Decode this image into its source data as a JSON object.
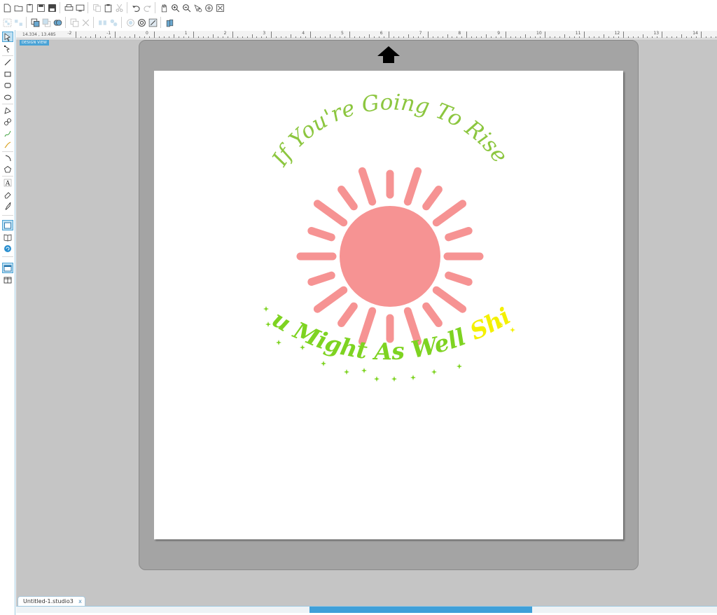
{
  "app": {
    "view_label": "DESIGN VIEW",
    "coordinate_readout": "14.334 , 13.485"
  },
  "ruler": {
    "labels": [
      "-2",
      "-1",
      "0",
      "1",
      "2",
      "3",
      "4",
      "5",
      "6",
      "7",
      "8",
      "9",
      "10",
      "11",
      "12",
      "13",
      "14"
    ]
  },
  "design": {
    "top_text": "If You're Going To Rise",
    "bottom_text_main": "You Might As Well",
    "bottom_text_accent": "Shine",
    "colors": {
      "top_text": "#8cc63f",
      "sun": "#f69393",
      "bottom_main": "#7ed321",
      "bottom_accent": "#f4f000"
    }
  },
  "document": {
    "tab_title": "Untitled-1.studio3",
    "tab_close": "x"
  },
  "toolbar_row1_icons": [
    "new-file-icon",
    "open-file-icon",
    "clipboard-icon",
    "save-icon",
    "save-as-icon",
    "print-icon",
    "print-cut-icon",
    "copy-icon",
    "paste-icon",
    "cut-icon",
    "undo-icon",
    "redo-icon",
    "pan-icon",
    "zoom-in-icon",
    "zoom-out-icon",
    "zoom-select-icon",
    "pan-hand-icon",
    "fit-page-icon"
  ],
  "toolbar_row2_icons": [
    "group-icon",
    "ungroup-icon",
    "bring-front-icon",
    "send-back-icon",
    "weld-icon",
    "delete-icon",
    "align-icon",
    "distribute-icon",
    "replicate-icon",
    "offset-icon",
    "trace-icon",
    "knife-icon"
  ],
  "left_tools": [
    "select-tool-icon",
    "edit-points-icon",
    "line-tool-icon",
    "rectangle-tool-icon",
    "rounded-rect-icon",
    "ellipse-tool-icon",
    "polygon-tool-icon",
    "curve-tool-icon",
    "freehand-tool-icon",
    "smooth-freehand-icon",
    "arc-tool-icon",
    "regular-polygon-icon",
    "text-tool-icon",
    "eraser-tool-icon",
    "knife-tool-icon",
    "page-setup-icon",
    "library-icon",
    "store-icon",
    "design-view-icon",
    "split-view-icon"
  ]
}
